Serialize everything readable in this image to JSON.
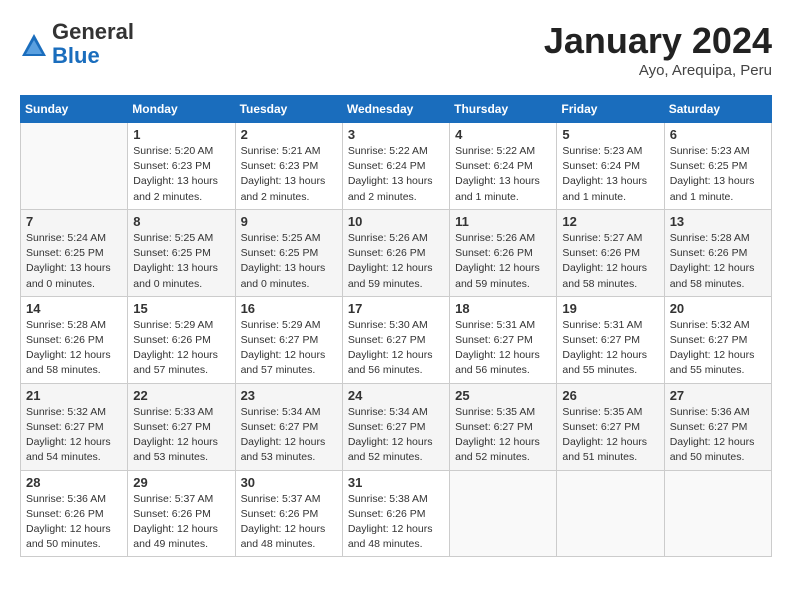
{
  "header": {
    "logo": {
      "general": "General",
      "blue": "Blue"
    },
    "title": "January 2024",
    "location": "Ayo, Arequipa, Peru"
  },
  "calendar": {
    "columns": [
      "Sunday",
      "Monday",
      "Tuesday",
      "Wednesday",
      "Thursday",
      "Friday",
      "Saturday"
    ],
    "weeks": [
      {
        "days": [
          {
            "num": "",
            "info": ""
          },
          {
            "num": "1",
            "info": "Sunrise: 5:20 AM\nSunset: 6:23 PM\nDaylight: 13 hours\nand 2 minutes."
          },
          {
            "num": "2",
            "info": "Sunrise: 5:21 AM\nSunset: 6:23 PM\nDaylight: 13 hours\nand 2 minutes."
          },
          {
            "num": "3",
            "info": "Sunrise: 5:22 AM\nSunset: 6:24 PM\nDaylight: 13 hours\nand 2 minutes."
          },
          {
            "num": "4",
            "info": "Sunrise: 5:22 AM\nSunset: 6:24 PM\nDaylight: 13 hours\nand 1 minute."
          },
          {
            "num": "5",
            "info": "Sunrise: 5:23 AM\nSunset: 6:24 PM\nDaylight: 13 hours\nand 1 minute."
          },
          {
            "num": "6",
            "info": "Sunrise: 5:23 AM\nSunset: 6:25 PM\nDaylight: 13 hours\nand 1 minute."
          }
        ]
      },
      {
        "days": [
          {
            "num": "7",
            "info": "Sunrise: 5:24 AM\nSunset: 6:25 PM\nDaylight: 13 hours\nand 0 minutes."
          },
          {
            "num": "8",
            "info": "Sunrise: 5:25 AM\nSunset: 6:25 PM\nDaylight: 13 hours\nand 0 minutes."
          },
          {
            "num": "9",
            "info": "Sunrise: 5:25 AM\nSunset: 6:25 PM\nDaylight: 13 hours\nand 0 minutes."
          },
          {
            "num": "10",
            "info": "Sunrise: 5:26 AM\nSunset: 6:26 PM\nDaylight: 12 hours\nand 59 minutes."
          },
          {
            "num": "11",
            "info": "Sunrise: 5:26 AM\nSunset: 6:26 PM\nDaylight: 12 hours\nand 59 minutes."
          },
          {
            "num": "12",
            "info": "Sunrise: 5:27 AM\nSunset: 6:26 PM\nDaylight: 12 hours\nand 58 minutes."
          },
          {
            "num": "13",
            "info": "Sunrise: 5:28 AM\nSunset: 6:26 PM\nDaylight: 12 hours\nand 58 minutes."
          }
        ]
      },
      {
        "days": [
          {
            "num": "14",
            "info": "Sunrise: 5:28 AM\nSunset: 6:26 PM\nDaylight: 12 hours\nand 58 minutes."
          },
          {
            "num": "15",
            "info": "Sunrise: 5:29 AM\nSunset: 6:26 PM\nDaylight: 12 hours\nand 57 minutes."
          },
          {
            "num": "16",
            "info": "Sunrise: 5:29 AM\nSunset: 6:27 PM\nDaylight: 12 hours\nand 57 minutes."
          },
          {
            "num": "17",
            "info": "Sunrise: 5:30 AM\nSunset: 6:27 PM\nDaylight: 12 hours\nand 56 minutes."
          },
          {
            "num": "18",
            "info": "Sunrise: 5:31 AM\nSunset: 6:27 PM\nDaylight: 12 hours\nand 56 minutes."
          },
          {
            "num": "19",
            "info": "Sunrise: 5:31 AM\nSunset: 6:27 PM\nDaylight: 12 hours\nand 55 minutes."
          },
          {
            "num": "20",
            "info": "Sunrise: 5:32 AM\nSunset: 6:27 PM\nDaylight: 12 hours\nand 55 minutes."
          }
        ]
      },
      {
        "days": [
          {
            "num": "21",
            "info": "Sunrise: 5:32 AM\nSunset: 6:27 PM\nDaylight: 12 hours\nand 54 minutes."
          },
          {
            "num": "22",
            "info": "Sunrise: 5:33 AM\nSunset: 6:27 PM\nDaylight: 12 hours\nand 53 minutes."
          },
          {
            "num": "23",
            "info": "Sunrise: 5:34 AM\nSunset: 6:27 PM\nDaylight: 12 hours\nand 53 minutes."
          },
          {
            "num": "24",
            "info": "Sunrise: 5:34 AM\nSunset: 6:27 PM\nDaylight: 12 hours\nand 52 minutes."
          },
          {
            "num": "25",
            "info": "Sunrise: 5:35 AM\nSunset: 6:27 PM\nDaylight: 12 hours\nand 52 minutes."
          },
          {
            "num": "26",
            "info": "Sunrise: 5:35 AM\nSunset: 6:27 PM\nDaylight: 12 hours\nand 51 minutes."
          },
          {
            "num": "27",
            "info": "Sunrise: 5:36 AM\nSunset: 6:27 PM\nDaylight: 12 hours\nand 50 minutes."
          }
        ]
      },
      {
        "days": [
          {
            "num": "28",
            "info": "Sunrise: 5:36 AM\nSunset: 6:26 PM\nDaylight: 12 hours\nand 50 minutes."
          },
          {
            "num": "29",
            "info": "Sunrise: 5:37 AM\nSunset: 6:26 PM\nDaylight: 12 hours\nand 49 minutes."
          },
          {
            "num": "30",
            "info": "Sunrise: 5:37 AM\nSunset: 6:26 PM\nDaylight: 12 hours\nand 48 minutes."
          },
          {
            "num": "31",
            "info": "Sunrise: 5:38 AM\nSunset: 6:26 PM\nDaylight: 12 hours\nand 48 minutes."
          },
          {
            "num": "",
            "info": ""
          },
          {
            "num": "",
            "info": ""
          },
          {
            "num": "",
            "info": ""
          }
        ]
      }
    ]
  }
}
